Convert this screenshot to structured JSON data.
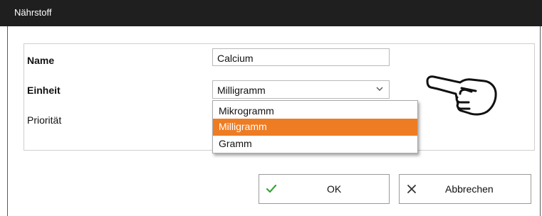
{
  "window": {
    "title": "Nährstoff"
  },
  "form": {
    "name_label": "Name",
    "name_value": "Calcium",
    "unit_label": "Einheit",
    "unit_selected": "Milligramm",
    "priority_label": "Priorität"
  },
  "dropdown": {
    "options": [
      "Mikrogramm",
      "Milligramm",
      "Gramm"
    ],
    "highlighted_index": 1,
    "highlight_color": "#ee7c23"
  },
  "buttons": {
    "ok_label": "OK",
    "cancel_label": "Abbrechen",
    "ok_icon": "check-icon",
    "cancel_icon": "close-icon",
    "ok_icon_color": "#3aa33a"
  },
  "annotation": {
    "icon": "pointing-hand-icon"
  }
}
